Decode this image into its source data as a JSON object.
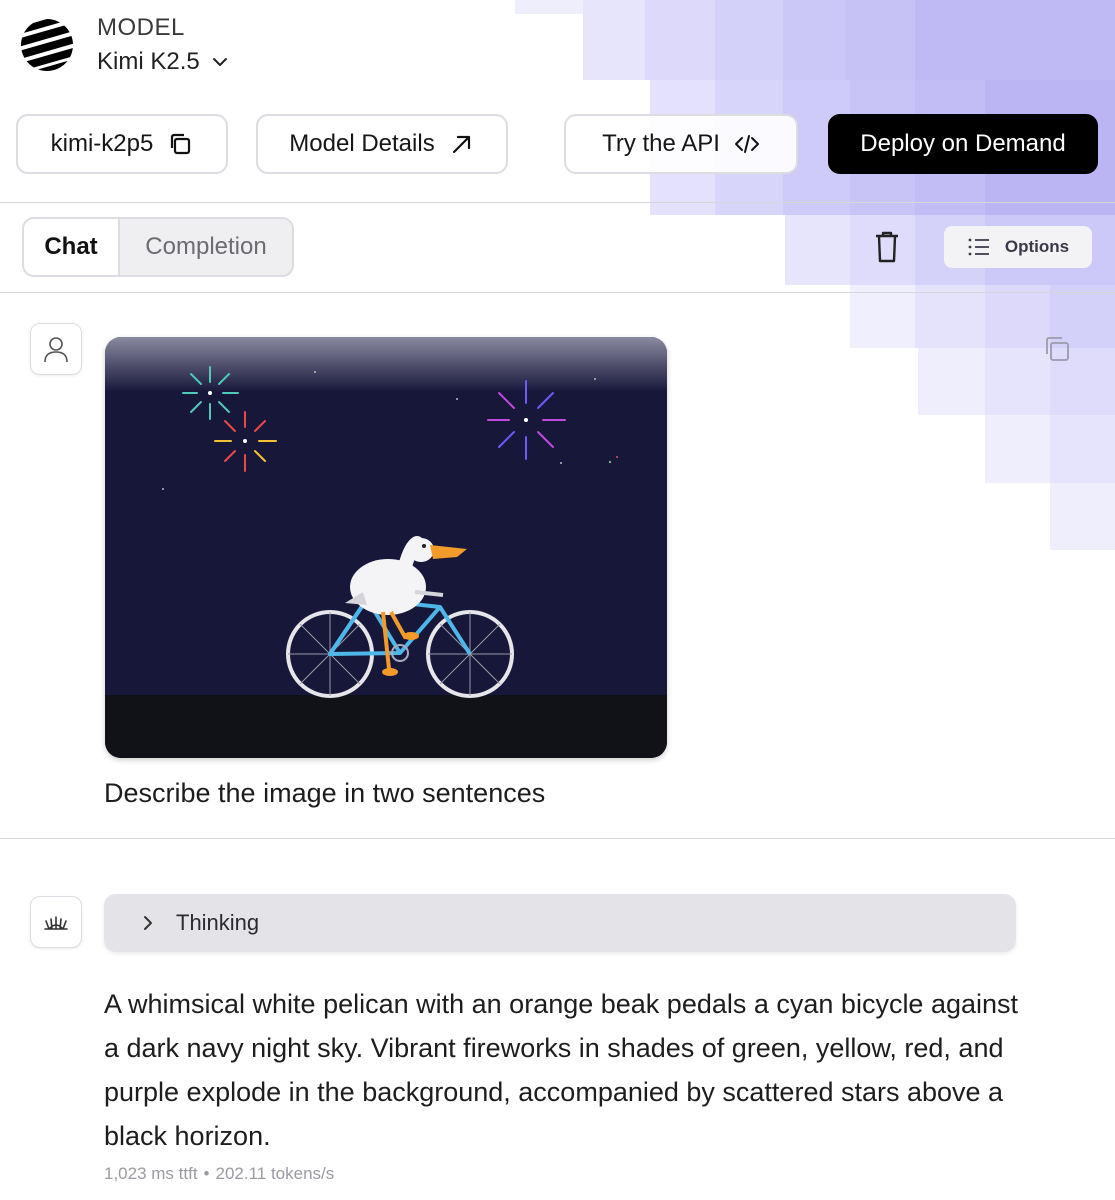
{
  "header": {
    "caption": "MODEL",
    "model_name": "Kimi K2.5"
  },
  "toolbar": {
    "model_id": "kimi-k2p5",
    "details_label": "Model Details",
    "api_label": "Try the API",
    "deploy_label": "Deploy on Demand"
  },
  "tabs": {
    "chat": "Chat",
    "completion": "Completion"
  },
  "controls": {
    "options_label": "Options"
  },
  "messages": {
    "user_prompt": "Describe the image in two sentences",
    "thinking_label": "Thinking",
    "assistant_reply": "A whimsical white pelican with an orange beak pedals a cyan bicycle against a dark navy night sky. Vibrant fireworks in shades of green, yellow, red, and purple explode in the background, accompanied by scattered stars above a black horizon.",
    "stats_ttft": "1,023 ms ttft",
    "stats_separator": "•",
    "stats_speed": "202.11 tokens/s"
  },
  "colors": {
    "accent_black": "#000000",
    "mosaic": "#c9c6f5",
    "image_sky": "#17173a",
    "image_ground": "#111118"
  },
  "icons": [
    "logo-icon",
    "chevron-down-icon",
    "copy-icon",
    "arrow-up-right-icon",
    "code-icon",
    "trash-icon",
    "list-icon",
    "user-icon",
    "bot-icon",
    "chevron-right-icon"
  ]
}
